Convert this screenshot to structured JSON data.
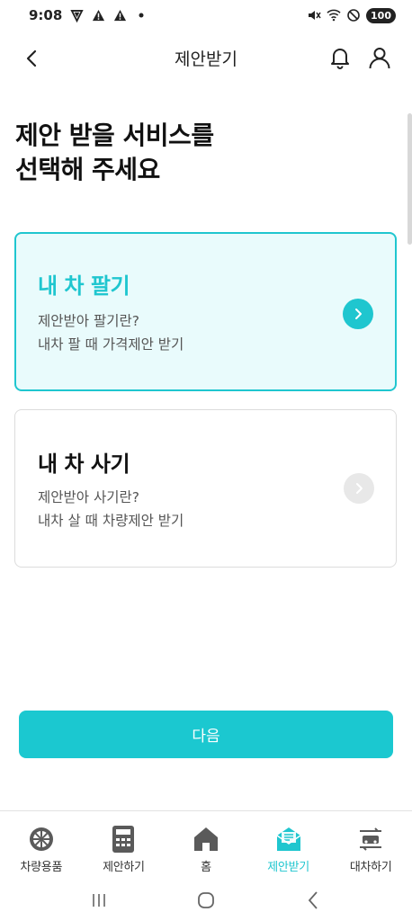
{
  "status_bar": {
    "time": "9:08",
    "battery": "100"
  },
  "header": {
    "title": "제안받기"
  },
  "page": {
    "heading_line1": "제안 받을 서비스를",
    "heading_line2": "선택해 주세요"
  },
  "cards": [
    {
      "title": "내 차 팔기",
      "desc_line1": "제안받아 팔기란?",
      "desc_line2": "내차 팔 때 가격제안 받기",
      "selected": true
    },
    {
      "title": "내 차 사기",
      "desc_line1": "제안받아 사기란?",
      "desc_line2": "내차 살 때 차량제안 받기",
      "selected": false
    }
  ],
  "next_button": {
    "label": "다음"
  },
  "bottom_nav": {
    "items": [
      {
        "label": "차량용품",
        "icon": "tire-icon"
      },
      {
        "label": "제안하기",
        "icon": "calculator-icon"
      },
      {
        "label": "홈",
        "icon": "home-icon"
      },
      {
        "label": "제안받기",
        "icon": "envelope-icon",
        "active": true
      },
      {
        "label": "대차하기",
        "icon": "car-swap-icon"
      }
    ]
  },
  "colors": {
    "accent": "#1fc6cf",
    "button": "#1bc8d0",
    "selected_card_bg": "#e9fbfc"
  }
}
